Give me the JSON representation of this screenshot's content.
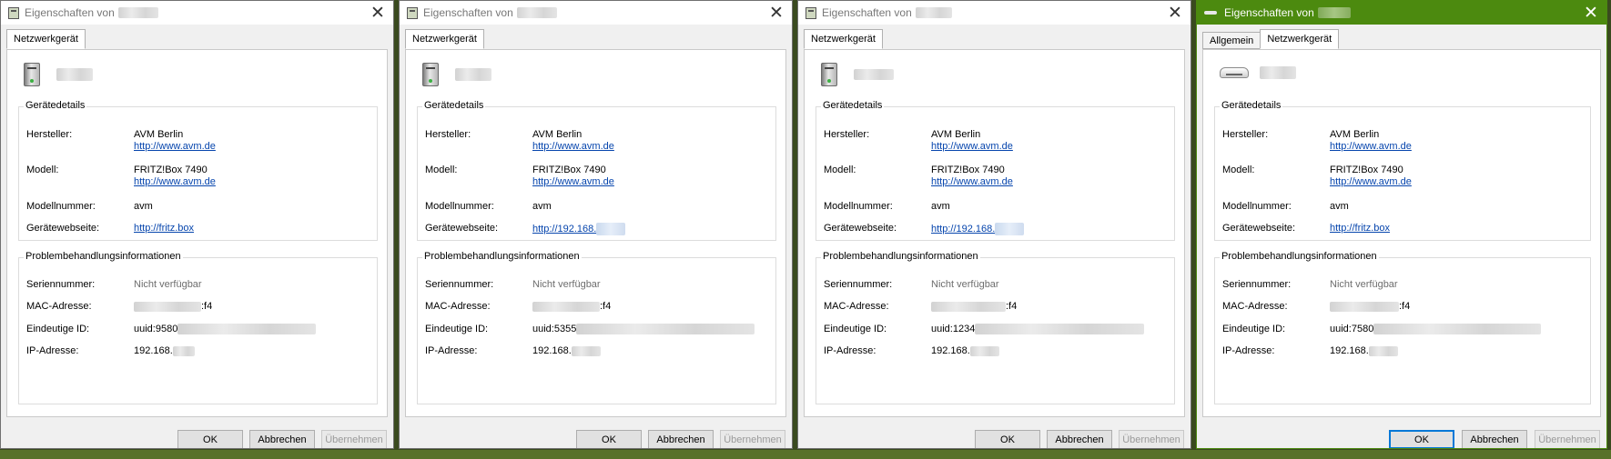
{
  "title_prefix": "Eigenschaften von",
  "tabs": {
    "general": "Allgemein",
    "network": "Netzwerkgerät"
  },
  "groups": {
    "details": "Gerätedetails",
    "troubleshooting": "Problembehandlungsinformationen"
  },
  "labels": {
    "manufacturer": "Hersteller:",
    "model": "Modell:",
    "model_number": "Modellnummer:",
    "website": "Gerätewebseite:",
    "serial": "Seriennummer:",
    "mac": "MAC-Adresse:",
    "uid": "Eindeutige ID:",
    "ip": "IP-Adresse:"
  },
  "buttons": {
    "ok": "OK",
    "cancel": "Abbrechen",
    "apply": "Übernehmen"
  },
  "dialogs": [
    {
      "manufacturer": "AVM Berlin",
      "manufacturer_url": "http://www.avm.de",
      "model": "FRITZ!Box 7490",
      "model_url": "http://www.avm.de",
      "model_number": "avm",
      "website": "http://fritz.box",
      "serial": "Nicht verfügbar",
      "mac_suffix": ":f4",
      "uid_prefix": "uuid:9580",
      "ip_prefix": "192.168."
    },
    {
      "manufacturer": "AVM Berlin",
      "manufacturer_url": "http://www.avm.de",
      "model": "FRITZ!Box 7490",
      "model_url": "http://www.avm.de",
      "model_number": "avm",
      "website": "http://192.168.",
      "serial": "Nicht verfügbar",
      "mac_suffix": ":f4",
      "uid_prefix": "uuid:5355",
      "ip_prefix": "192.168."
    },
    {
      "manufacturer": "AVM Berlin",
      "manufacturer_url": "http://www.avm.de",
      "model": "FRITZ!Box 7490",
      "model_url": "http://www.avm.de",
      "model_number": "avm",
      "website": "http://192.168.",
      "serial": "Nicht verfügbar",
      "mac_suffix": ":f4",
      "uid_prefix": "uuid:1234",
      "ip_prefix": "192.168."
    },
    {
      "manufacturer": "AVM Berlin",
      "manufacturer_url": "http://www.avm.de",
      "model": "FRITZ!Box 7490",
      "model_url": "http://www.avm.de",
      "model_number": "avm",
      "website": "http://fritz.box",
      "serial": "Nicht verfügbar",
      "mac_suffix": ":f4",
      "uid_prefix": "uuid:7580",
      "ip_prefix": "192.168."
    }
  ],
  "colors": {
    "active_titlebar": "#4c8a0f",
    "link": "#0645ad"
  },
  "icons": {
    "device": "network-device-icon",
    "router": "router-icon"
  }
}
